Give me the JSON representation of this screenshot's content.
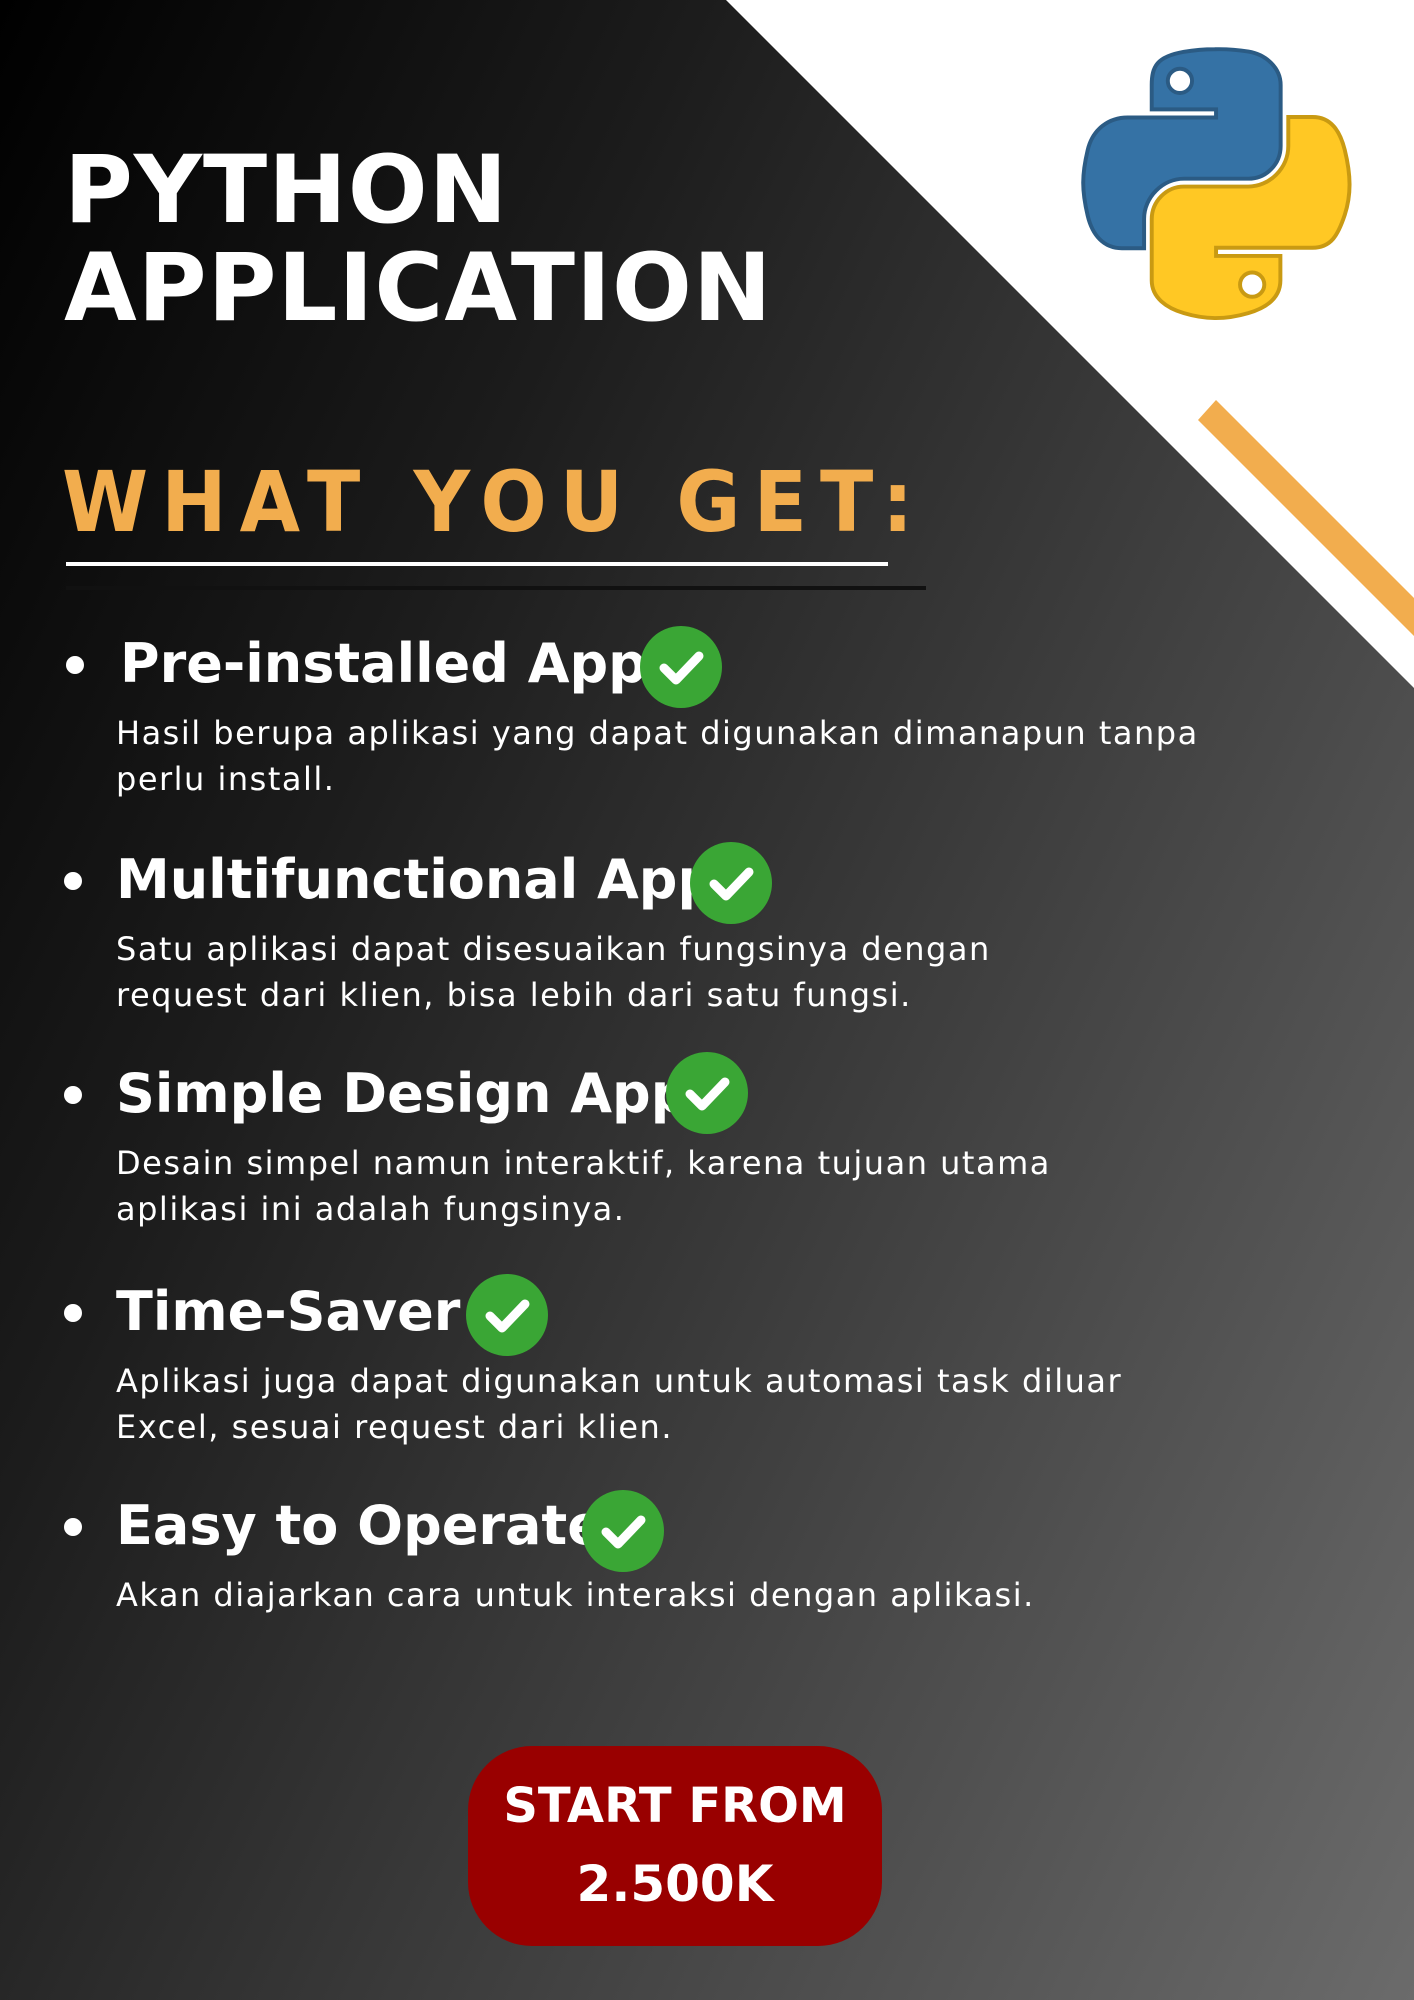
{
  "title": {
    "line1": "PYTHON",
    "line2": "APPLICATION"
  },
  "subtitle": "WHAT YOU GET:",
  "features": [
    {
      "title": "Pre-installed App",
      "description": "Hasil berupa aplikasi yang dapat digunakan dimanapun tanpa perlu install."
    },
    {
      "title": "Multifunctional App",
      "description": "Satu aplikasi dapat disesuaikan fungsinya dengan request dari klien, bisa lebih dari satu fungsi."
    },
    {
      "title": "Simple Design App",
      "description": "Desain simpel namun interaktif, karena tujuan utama aplikasi ini adalah fungsinya."
    },
    {
      "title": "Time-Saver",
      "description": "Aplikasi juga dapat digunakan untuk automasi task diluar Excel, sesuai request dari klien."
    },
    {
      "title": "Easy to Operate",
      "description": "Akan diajarkan cara untuk interaksi dengan aplikasi."
    }
  ],
  "cta": {
    "line1": "START FROM",
    "line2": "2.500K"
  },
  "icons": {
    "logo": "python-logo",
    "feature_check": "check-circle-icon"
  },
  "colors": {
    "accent_orange": "#f2ad4e",
    "check_green": "#3aa635",
    "cta_red": "#990000",
    "python_blue": "#3572a5",
    "python_yellow": "#ffc824"
  }
}
